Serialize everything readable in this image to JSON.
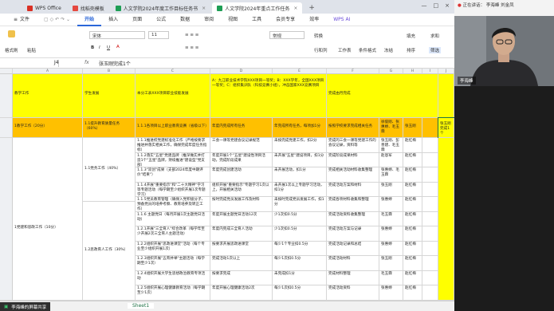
{
  "tabs": [
    {
      "label": "WPS Office",
      "color": "#d93025"
    },
    {
      "label": "找稻壳模板",
      "color": "#e5483f"
    },
    {
      "label": "人文学院2024年度工作目标任务书",
      "color": "#1e9e55"
    },
    {
      "label": "人文学院2024年重点工作任务",
      "color": "#1e9e55"
    }
  ],
  "menu": {
    "file": "文件",
    "items": [
      "开始",
      "插入",
      "页面",
      "公式",
      "数据",
      "审阅",
      "视图",
      "工具",
      "会员专享",
      "效率",
      "WPS AI"
    ],
    "active": "开始"
  },
  "ribbon": {
    "format_painter": "格式刷",
    "paste": "粘贴",
    "font": "宋体",
    "font_size": "11",
    "number_format": "常规",
    "convert": "转换",
    "row_col": "行和列",
    "worksheet": "工作表",
    "cond_format": "条件格式",
    "fill": "填充",
    "sort": "排序",
    "freeze": "冻结",
    "filter": "筛选",
    "find": "查找",
    "sum": "求和"
  },
  "formula_bar": {
    "cell_ref": "J4",
    "fx": "fx",
    "content": "张玉刚完成1个"
  },
  "columns": [
    "A",
    "B",
    "C",
    "D",
    "E",
    "F",
    "G",
    "H",
    "I",
    "J"
  ],
  "header_row": {
    "a": "教学工作",
    "b": "学生发展",
    "c": "本分工表XXX项目职业技能发展",
    "d": "A：九江职业技术学院XXX项目一等奖；B：XXX学年，全国XXX项目一等奖；C：组织集训队（科技竞赛小组），冲击国家XXX竞赛项目",
    "f": "完成由月完成"
  },
  "highlight_row": {
    "a": "1教学工作（20分）",
    "b": "1.1提升教育质量任务（60%）",
    "c": "1.1.1各项目以上职业教育竞赛（省级以下）",
    "d": "年度内完成所有任务",
    "e": "年完成所有任务，每项加1分",
    "f": "按照学校要求完成相关任务",
    "g": "徐俊刚、张惠婷、毛玉霖",
    "h": "张玉刚",
    "j": "张玉刚完成1个"
  },
  "section_labels": {
    "s1": "1.1党务工作（40%）",
    "s2": "1.2思政育人工作（30%）",
    "main": "1党建和思政工作（10分）"
  },
  "rows": [
    {
      "c": "1.1.1推进校党建标准化工作（严格按要求推进并落实相关工作，确保完成年度任务指标）",
      "d": "三会一课等党建会议记录规范",
      "e": "未按完成党建工作，扣2分",
      "f": "完成的三会一课等党建工作的会议记录，资料等",
      "g": "张玉刚、彭善建、毛玉霖",
      "h": "赵红梅"
    },
    {
      "c": "1.1.2落实\"五星\"党建品牌（推深做实并打造1个\"五星\"品牌，持续推进\"建设型\"党支部）",
      "d": "年度开展1个\"五星\"建设性项目活动，完成阶段成果",
      "e": "未开展\"五星\"建设项目，扣1分",
      "f": "完成阶段成果材料",
      "g": "赵恩军",
      "h": "赵红梅"
    },
    {
      "c": "1.1.3\"双创\"成果（支部2024年度中期评价\"结果\"）",
      "d": "年度完成创建活动",
      "e": "未开展活动，扣1分",
      "f": "完成相关活动材料收集整理",
      "g": "张惠婷、毛玉霖",
      "h": "赵红梅"
    },
    {
      "c": "1.1.4开展\"重要指示\"和\"二十大精神\"学习等专题活动（每学期至少组织开展1次专题学习）",
      "d": "组织开展\"重要指示\"专题学习1次以上，开展相关活动",
      "e": "未开展1次以上专题学习活动，扣1分",
      "f": "完成活动方案和材料",
      "g": "张玉刚",
      "h": "赵红梅"
    },
    {
      "c": "1.1.5党员教育管理（确保入党积极分子、预备党员的培养考察、教育培养及转正工作）",
      "d": "按时完成党员发展工作及材料",
      "e": "未按时完成党员发展工作，扣1分",
      "f": "完成各项材料收集和整理",
      "g": "张惠婷",
      "h": "赵红梅"
    },
    {
      "c": "1.1.6 主题党日（每月开展1次主题党日活动）",
      "d": "年度开展主题党日活动12次",
      "e": "少1次扣0.5分",
      "f": "完成活动资料收集整理",
      "g": "毛玉霖",
      "h": "赵红梅"
    },
    {
      "c": "1.2.1开展\"三全育人\"综合改革（每学年至少开展2次三全育人主题活动）",
      "d": "年度内完成三全育人活动",
      "e": "少1次扣0.5分",
      "f": "完成活动方案与记录",
      "g": "张惠婷",
      "h": "赵红梅"
    },
    {
      "c": "1.2.2组织开展\"思政进课堂\"活动（每个专业至少组织开展1次）",
      "d": "按要求开展思政进课堂",
      "e": "每少1个专业扣0.5分",
      "f": "完成活动记录和总结",
      "g": "张惠婷",
      "h": "赵红梅"
    },
    {
      "c": "1.2.3组织开展\"五育并举\"主题活动（每学期至少1次）",
      "d": "完成活动1次以上",
      "e": "每少1次扣0.5分",
      "f": "完成活动材料",
      "g": "张玉刚",
      "h": "赵红梅"
    },
    {
      "c": "1.2.4组织开展大学生思想政治教育专项活动",
      "d": "按要求完成",
      "e": "未完成扣1分",
      "f": "完成材料整理",
      "g": "毛玉霖",
      "h": "赵红梅"
    },
    {
      "c": "1.2.5组织开展心理健康教育活动（每学期至少1次）",
      "d": "年度开展心理健康活动2次",
      "e": "每少1次扣0.5分",
      "f": "完成活动资料",
      "g": "张惠婷",
      "h": "赵红梅"
    }
  ],
  "sheet_tab": "Sheet1",
  "share_bar": "李海峰的屏幕共享",
  "meeting": {
    "status": "正在讲话：",
    "speaker": "李海峰",
    "also": "刘金凤",
    "video_label": "李海峰"
  }
}
